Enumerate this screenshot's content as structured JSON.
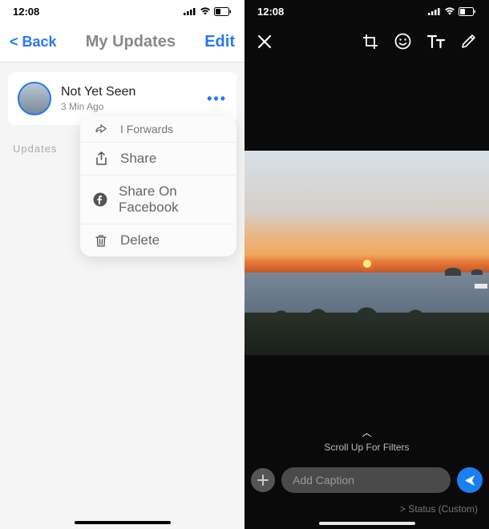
{
  "status_bar": {
    "time": "12:08"
  },
  "left": {
    "nav": {
      "back": "< Back",
      "title": "My Updates",
      "edit": "Edit"
    },
    "card": {
      "title": "Not Yet Seen",
      "time": "3 Min Ago",
      "more": "•••"
    },
    "section_label": "Updates",
    "menu": {
      "forwards": "I Forwards",
      "share": "Share",
      "share_fb": "Share On Facebook",
      "delete": "Delete"
    }
  },
  "right": {
    "filter_hint": "Scroll Up For Filters",
    "caption_placeholder": "Add Caption",
    "recipient": "> Status (Custom)"
  }
}
